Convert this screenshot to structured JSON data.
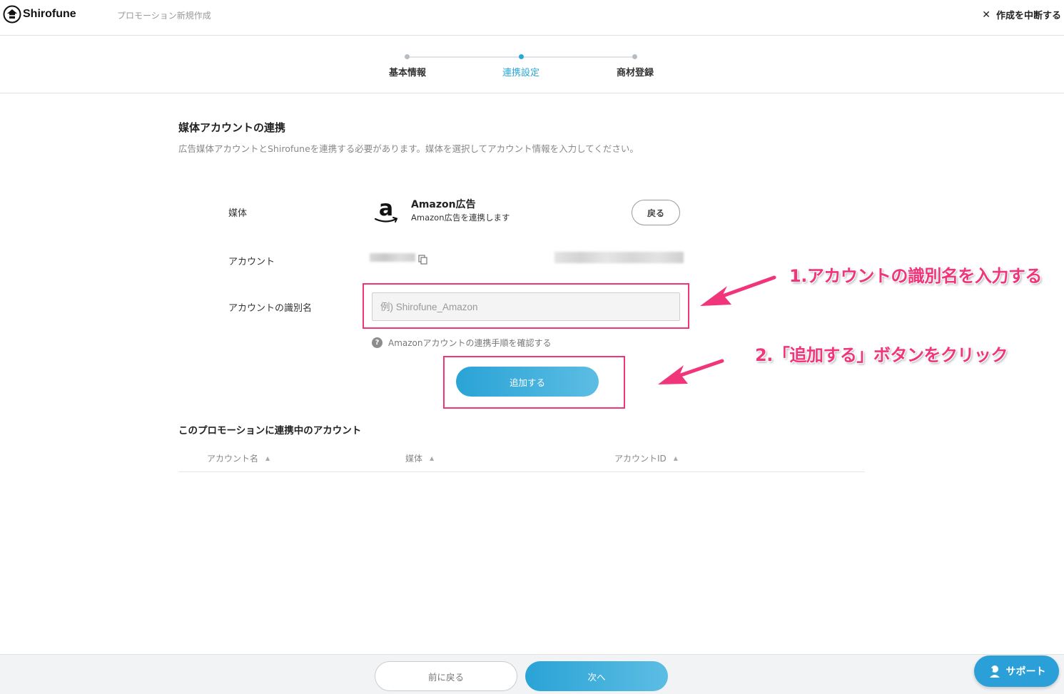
{
  "header": {
    "brand": "Shirofune",
    "page_title": "プロモーション新規作成",
    "abort_label": "作成を中断する"
  },
  "stepper": {
    "steps": [
      {
        "label": "基本情報",
        "active": false
      },
      {
        "label": "連携設定",
        "active": true
      },
      {
        "label": "商材登録",
        "active": false
      }
    ],
    "accent_color": "#2aa7d6"
  },
  "section": {
    "title": "媒体アカウントの連携",
    "description": "広告媒体アカウントとShirofuneを連携する必要があります。媒体を選択してアカウント情報を入力してください。"
  },
  "form": {
    "media_label": "媒体",
    "media_name": "Amazon広告",
    "media_sub": "Amazon広告を連携します",
    "media_logo": "amazon-logo",
    "back_label": "戻る",
    "account_label": "アカウント",
    "identifier_label": "アカウントの識別名",
    "identifier_placeholder": "例) Shirofune_Amazon",
    "identifier_value": "",
    "help_text": "Amazonアカウントの連携手順を確認する",
    "add_label": "追加する"
  },
  "annotations": {
    "step1": "1.アカウントの識別名を入力する",
    "step2": "2.「追加する」ボタンをクリック",
    "highlight_color": "#f0357a"
  },
  "linked": {
    "title": "このプロモーションに連携中のアカウント",
    "columns": [
      "アカウント名",
      "媒体",
      "アカウントID"
    ]
  },
  "footer": {
    "prev_label": "前に戻る",
    "next_label": "次へ",
    "support_label": "サポート"
  }
}
